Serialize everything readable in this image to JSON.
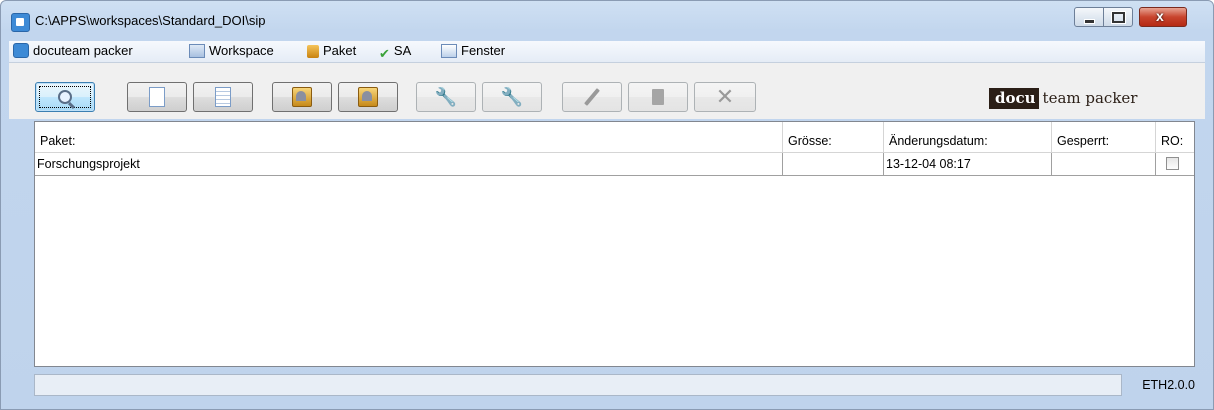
{
  "window": {
    "title": "C:\\APPS\\workspaces\\Standard_DOI\\sip",
    "controls": {
      "minimize": "minimize-icon",
      "maximize": "maximize-icon",
      "close": "close-icon",
      "close_glyph": "x"
    }
  },
  "menu": {
    "items": [
      {
        "label": "docuteam packer",
        "icon": "app-icon"
      },
      {
        "label": "Workspace",
        "icon": "workspace-icon"
      },
      {
        "label": "Paket",
        "icon": "package-icon"
      },
      {
        "label": "SA",
        "icon": "checkmark-icon"
      },
      {
        "label": "Fenster",
        "icon": "window-icon"
      }
    ]
  },
  "toolbar": {
    "buttons": [
      {
        "icon": "search-icon",
        "state": "focused"
      },
      {
        "icon": "new-document-icon",
        "state": "enabled"
      },
      {
        "icon": "document-lines-icon",
        "state": "enabled"
      },
      {
        "icon": "open-package-icon",
        "state": "enabled"
      },
      {
        "icon": "lock-package-icon",
        "state": "enabled"
      },
      {
        "icon": "wrench-icon",
        "state": "disabled"
      },
      {
        "icon": "wrench-2-icon",
        "state": "disabled"
      },
      {
        "icon": "pencil-icon",
        "state": "disabled"
      },
      {
        "icon": "copy-icon",
        "state": "disabled"
      },
      {
        "icon": "delete-icon",
        "state": "disabled"
      }
    ],
    "brand": {
      "part1": "docu",
      "part2": "team packer"
    }
  },
  "table": {
    "columns": [
      "Paket:",
      "Grösse:",
      "Änderungsdatum:",
      "Gesperrt:",
      "RO:"
    ],
    "rows": [
      {
        "paket": "Forschungsprojekt",
        "groesse": "",
        "datum": "13-12-04 08:17",
        "gesperrt": "",
        "ro": false
      }
    ]
  },
  "status": {
    "text": "",
    "version": "ETH2.0.0"
  }
}
